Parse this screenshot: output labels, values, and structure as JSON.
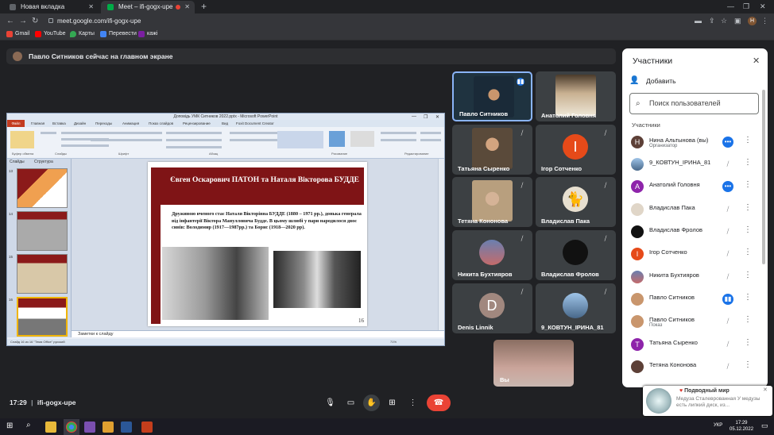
{
  "browser": {
    "tabs": [
      {
        "title": "Новая вкладка"
      },
      {
        "title": "Meet – ifi-gogx-upe"
      }
    ],
    "url": "meet.google.com/ifi-gogx-upe",
    "avatar_letter": "H",
    "bookmarks": [
      "Gmail",
      "YouTube",
      "Карты",
      "Перевести",
      "кажі"
    ]
  },
  "meet": {
    "banner": "Павло Ситников сейчас на главном экране",
    "meeting_code": "ifi-gogx-upe",
    "time": "17:29",
    "tiles": [
      {
        "name": "Павло Ситников",
        "speaking": true
      },
      {
        "name": "Анатолий Головня"
      },
      {
        "name": "Татьяна Сыренко"
      },
      {
        "name": "Ігор Сотченко",
        "letter": "І"
      },
      {
        "name": "Тетяна Кононова"
      },
      {
        "name": "Владислав Пака"
      },
      {
        "name": "Никита Бухтияров"
      },
      {
        "name": "Владислав Фролов"
      },
      {
        "name": "Denis Linnik",
        "letter": "D"
      },
      {
        "name": "9_КОВТУН_ІРИНА_81"
      }
    ],
    "self_tile": "Вы"
  },
  "presentation": {
    "window_title": "Доповідь УМК Ситников 2022.pptx - Microsoft PowerPoint",
    "file_tab": "Файл",
    "ribbon_tabs": [
      "Главная",
      "Вставка",
      "Дизайн",
      "Переходы",
      "Анимация",
      "Показ слайдов",
      "Рецензирование",
      "Вид",
      "Foxit Document Creator"
    ],
    "ribbon_groups": [
      "Буфер обмена",
      "Слайды",
      "Шрифт",
      "Абзац",
      "Рисование",
      "Редактирование"
    ],
    "panel_tabs": [
      "Слайды",
      "Структура"
    ],
    "thumb_numbers": [
      "13",
      "14",
      "15",
      "16"
    ],
    "slide_title": "Євген Оскарович ПАТОН та Наталя Вікторова БУДДЕ",
    "slide_text": "Дружиною вченого стає Наталя Вікторівна БУДДЕ (1880 – 1971 рр.), донька генерала від інфантерії Віктора Манулловича Будде. В цьому шлюбі у пари народилося двоє синів: Володимир (1917—1987рр.) та Борис (1918—2020 рр).",
    "slide_number": "16",
    "notes_placeholder": "Заметки к слайду",
    "status": "Слайд 16 из 16   \"Тема Office\"   русский",
    "zoom": "71%"
  },
  "participants": {
    "title": "Участники",
    "add_label": "Добавить",
    "search_placeholder": "Поиск пользователей",
    "section_label": "Участники",
    "list": [
      {
        "name": "Нина Альтынова (вы)",
        "subtitle": "Организатор",
        "letter": "Н",
        "color": "#5d4037",
        "status": "more"
      },
      {
        "name": "9_КОВТУН_ІРИНА_81",
        "subtitle": "",
        "letter": "",
        "color": "#607d8b",
        "status": "muted"
      },
      {
        "name": "Анатолий Головня",
        "subtitle": "",
        "letter": "А",
        "color": "#8e24aa",
        "status": "more"
      },
      {
        "name": "Владислав Пака",
        "subtitle": "",
        "letter": "",
        "color": "#424242",
        "status": "muted"
      },
      {
        "name": "Владислав Фролов",
        "subtitle": "",
        "letter": "",
        "color": "#212121",
        "status": "muted"
      },
      {
        "name": "Ігор Сотченко",
        "subtitle": "",
        "letter": "І",
        "color": "#e64a19",
        "status": "muted"
      },
      {
        "name": "Никита Бухтияров",
        "subtitle": "",
        "letter": "",
        "color": "#6d4c41",
        "status": "muted"
      },
      {
        "name": "Павло Ситников",
        "subtitle": "",
        "letter": "",
        "color": "#795548",
        "status": "speaking"
      },
      {
        "name": "Павло Ситников",
        "subtitle": "Показ",
        "letter": "",
        "color": "#795548",
        "status": "presenting"
      },
      {
        "name": "Татьяна Сыренко",
        "subtitle": "",
        "letter": "Т",
        "color": "#8e24aa",
        "status": "muted"
      },
      {
        "name": "Тетяна Кононова",
        "subtitle": "",
        "letter": "",
        "color": "#5d4037",
        "status": "muted"
      }
    ]
  },
  "toast": {
    "title": "Подводный мир",
    "text": "Медуза Сталеврованная У медузы есть липкий диск, из..."
  },
  "taskbar": {
    "time": "17:29",
    "date": "05.12.2022",
    "lang": "УКР"
  },
  "colors": {
    "accent_blue": "#1a73e8",
    "end_call": "#ea4335",
    "slide_red": "#7f1416"
  }
}
